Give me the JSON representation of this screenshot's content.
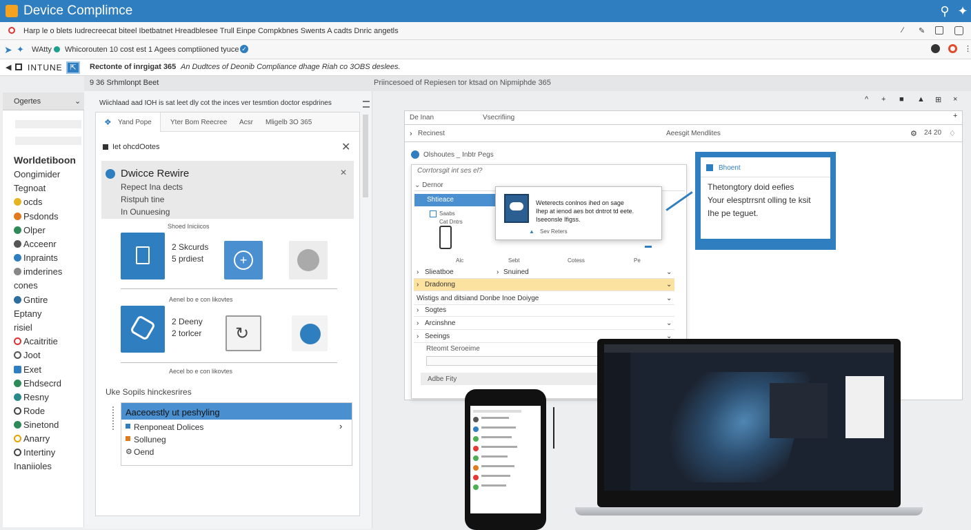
{
  "window": {
    "title": "Device Complimce"
  },
  "toolbar1": {
    "text": "Harp le o blets  Iudrecreecat biteel Ibetbatnet Hreadblesee Trull Einpe  Compkbnes  Swents A cadts Dnric angetls"
  },
  "toolbar2": {
    "text": "WAtty",
    "text2": "Whicorouten  10 cost est 1  Agees comptiioned tyuce"
  },
  "toolbar3": {
    "app": "INTUNE",
    "breadcrumb": "Rectonte of inrgigat 365",
    "breadcrumb2": "An Dudtces of Deonib Compliance dhage Riah co 3OBS deslees."
  },
  "header_band": {
    "left": "9 36 Srhmlonpt Beet",
    "right": "Priincesoed of Repiesen tor ktsad on Nipmiphde 365"
  },
  "sidebar": {
    "dropdown": "Ogertes",
    "items": [
      "Worldetiboon",
      "Oongimider",
      "Tegnoat",
      "ocds",
      "Psdonds",
      "Olper",
      "Acceenr",
      "Inpraints",
      "imderines",
      "cones",
      "Gntire",
      "Eptany",
      "risiel",
      "Acaitritie",
      "Joot",
      "Exet",
      "Ehdsecrd",
      "Resny",
      "Rode",
      "Sinetond",
      "Anarry",
      "Intertiny",
      "Inaniioles"
    ]
  },
  "mid": {
    "header": "Wiichlaad aad IOH is sat leet dly cot the inces ver tesmtion doctor espdrines",
    "tabs": [
      "Yand Pope",
      "Yter Bom Reecree",
      "Acsr",
      "Mligelb 3O 365"
    ],
    "section": "Iet ohcdOotes",
    "card": {
      "title": "Dwicce Rewire",
      "lines": [
        "Repect Ina dects",
        "Ristpuh tine",
        "In Ounuesing"
      ]
    },
    "caption1": "Shoed Iniciicos",
    "tile1": {
      "line1": "2 Skcurds",
      "line2": "5 prdiest"
    },
    "caption2": "Aenel bo e con likovtes",
    "tile2": {
      "line1": "2 Deeny",
      "line2": "2 torlcer"
    },
    "caption3": "Aecel bo e con likovtes",
    "list_title": "Uke Sopils hinckesrires",
    "list_header": "Aaceoestly ut peshyling",
    "list_items": [
      "Renponeat Dolices",
      "Solluneg",
      "Oend"
    ]
  },
  "right": {
    "icons": [
      "^",
      "+",
      "■",
      "▲",
      "⊞",
      "×"
    ],
    "table_head": [
      "De Inan",
      "Vsecrifiing"
    ],
    "row1": {
      "left": "Recinest",
      "mid": "Aeesgit Mendlites",
      "count": "24 20"
    },
    "sub": {
      "title": "Olshoutes _ Inbtr  Pegs",
      "placeholder": "Corrtorsgit int ses el?"
    },
    "tree": {
      "header": "Dernor",
      "selected": "Shtieace",
      "item_small1": "Saabs",
      "item_small2": "Cat Dntrs",
      "cols": [
        "Alc",
        "Sebt",
        "Cotess",
        "Pe"
      ]
    },
    "popover": {
      "line1": "Weterects conlnos ihed on sage",
      "line2": "Ihep at ienod aes bot dntrot td eete.",
      "line3": "Iseeonsle Ifigss.",
      "footer": "Sev Reters"
    },
    "rows": [
      "Slieatboe",
      "Snuined",
      "Dradonng",
      "Wistigs and ditsiand Donbe Inoe Doiyge",
      "Sogtes",
      "Arcinshne",
      "Seeings",
      "Rteomt Seroeime",
      "Adbe Fity"
    ],
    "info": {
      "title": "Bhoent",
      "body": [
        "Thetongtory doid eefies",
        "Your elesptrrsnt olling te ksit",
        "Ihe pe teguet."
      ]
    }
  },
  "accent": "#2f7ec0",
  "highlight": "#fbe2a0"
}
